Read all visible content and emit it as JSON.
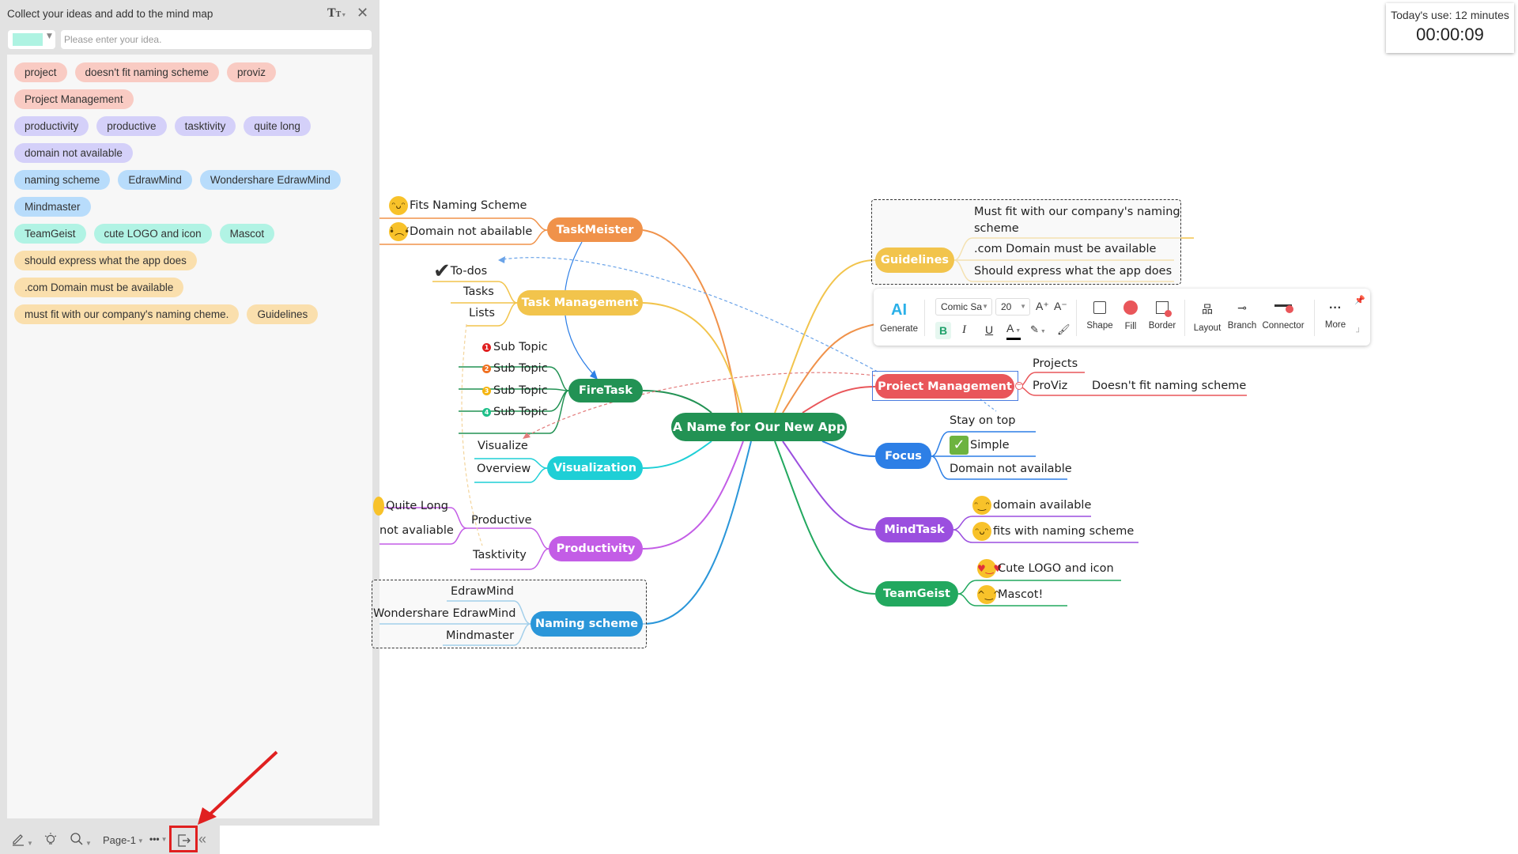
{
  "idea_panel": {
    "title": "Collect your ideas and add to the mind map",
    "text_style_icon": "text-style-icon",
    "close_icon": "close-icon",
    "selected_color": "#aef3e2",
    "input_placeholder": "Please enter your idea.",
    "input_value": "",
    "chip_rows": [
      [
        {
          "label": "project",
          "color": "red"
        },
        {
          "label": "doesn't fit naming scheme",
          "color": "red"
        },
        {
          "label": "proviz",
          "color": "red"
        }
      ],
      [
        {
          "label": "Project Management",
          "color": "red"
        }
      ],
      [
        {
          "label": "productivity",
          "color": "purple"
        },
        {
          "label": "productive",
          "color": "purple"
        },
        {
          "label": "tasktivity",
          "color": "purple"
        },
        {
          "label": "quite long",
          "color": "purple"
        }
      ],
      [
        {
          "label": "domain not available",
          "color": "purple"
        }
      ],
      [
        {
          "label": "naming scheme",
          "color": "blue"
        },
        {
          "label": "EdrawMind",
          "color": "blue"
        },
        {
          "label": "Wondershare EdrawMind",
          "color": "blue"
        }
      ],
      [
        {
          "label": "Mindmaster",
          "color": "blue"
        }
      ],
      [
        {
          "label": "TeamGeist",
          "color": "teal"
        },
        {
          "label": "cute LOGO and icon",
          "color": "teal"
        },
        {
          "label": "Mascot",
          "color": "teal"
        }
      ],
      [
        {
          "label": "should express what the app does",
          "color": "orange"
        }
      ],
      [
        {
          "label": ".com Domain must be available",
          "color": "orange"
        }
      ],
      [
        {
          "label": "must fit with our company's naming cheme.",
          "color": "orange"
        },
        {
          "label": "Guidelines",
          "color": "orange"
        }
      ]
    ]
  },
  "bottom_bar": {
    "pen_icon": "pen-icon",
    "idea_icon": "lightbulb-icon",
    "zoom_icon": "magnifier-icon",
    "page_label": "Page-1",
    "more_label": "•••",
    "export_icon": "export-icon",
    "collapse_icon": "double-chevron-left-icon"
  },
  "timer": {
    "label": "Today's use:  12 minutes",
    "value": "00:00:09"
  },
  "toolbar": {
    "ai_label": "AI",
    "generate_label": "Generate",
    "font_name": "Comic Sa",
    "font_size": "20",
    "increase_font": "A⁺",
    "decrease_font": "A⁻",
    "bold": "B",
    "italic": "I",
    "underline": "U",
    "font_color": "A",
    "shape_label": "Shape",
    "fill_label": "Fill",
    "border_label": "Border",
    "layout_label": "Layout",
    "branch_label": "Branch",
    "connector_label": "Connector",
    "more_label": "More",
    "more_glyph": "···"
  },
  "mindmap": {
    "central": "A Name for Our New App",
    "topics": {
      "taskmeister": {
        "label": "TaskMeister",
        "color": "#f0924a",
        "subs": [
          "Fits Naming Scheme",
          "Domain not abailable"
        ]
      },
      "task_management": {
        "label": "Task Management",
        "color": "#f2c44c",
        "subs": [
          "To-dos",
          "Tasks",
          "Lists"
        ]
      },
      "firetask": {
        "label": "FireTask",
        "color": "#229254",
        "subs": [
          "Sub Topic",
          "Sub Topic",
          "Sub Topic",
          "Sub Topic"
        ],
        "priorities": [
          "1",
          "2",
          "3",
          "4"
        ]
      },
      "visualization": {
        "label": "Visualization",
        "color": "#1ecfd6",
        "subs": [
          "Visualize",
          "Overview"
        ]
      },
      "productivity": {
        "label": "Productivity",
        "color": "#c35de6",
        "subs": [
          "Quite Long",
          "not avaliable",
          "Productive",
          "Tasktivity"
        ]
      },
      "naming_scheme": {
        "label": "Naming scheme",
        "color": "#2a96d9",
        "subs": [
          "EdrawMind",
          "Wondershare EdrawMind",
          "Mindmaster"
        ]
      },
      "guidelines": {
        "label": "Guidelines",
        "color": "#f2c44c",
        "subs": [
          "Must fit with our company's naming scheme",
          ".com Domain must be available",
          "Should express what the app does"
        ]
      },
      "project_management": {
        "label": "Proiect Management",
        "color": "#e9565a",
        "subs": [
          "Projects",
          "ProViz",
          "Doesn't fit naming scheme"
        ]
      },
      "focus": {
        "label": "Focus",
        "color": "#2d7fe6",
        "subs": [
          "Stay on top",
          "Simple",
          "Domain not available"
        ]
      },
      "mindtask": {
        "label": "MindTask",
        "color": "#9b4fdf",
        "subs": [
          "domain available",
          "fits with naming scheme"
        ]
      },
      "teamgeist": {
        "label": "TeamGeist",
        "color": "#22a85f",
        "subs": [
          "Cute LOGO and icon",
          "Mascot!"
        ]
      }
    }
  }
}
